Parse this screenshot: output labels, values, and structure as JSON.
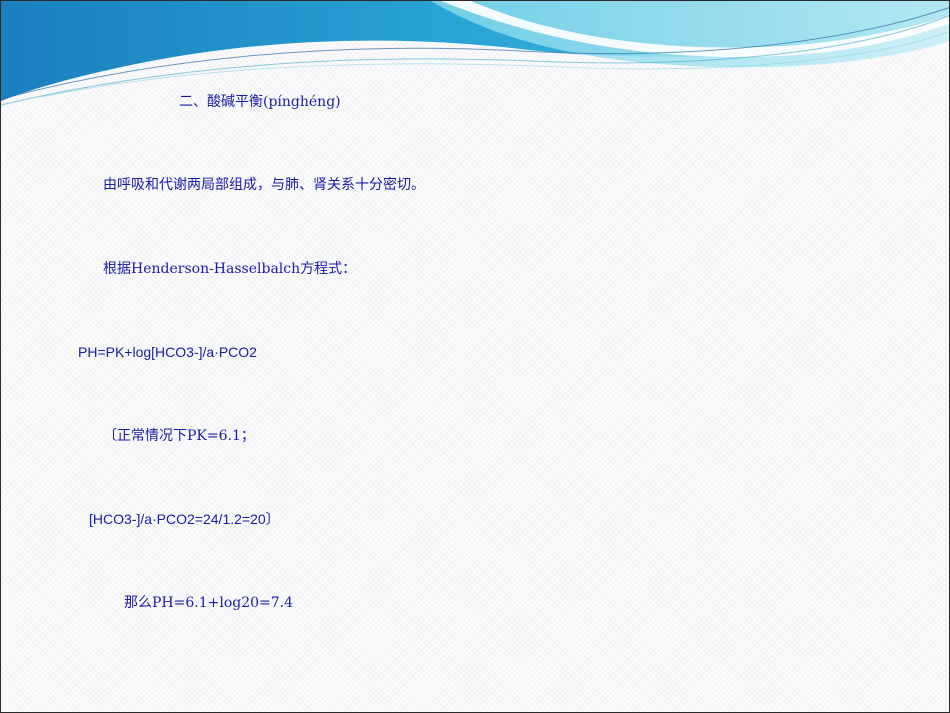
{
  "slide": {
    "lines": [
      "二、酸碱平衡(pínghéng)",
      "由呼吸和代谢两局部组成，与肺、肾关系十分密切。",
      "根据Henderson-Hasselbalch方程式：",
      "PH=PK+log[HCO3-]/a·PCO2",
      "〔正常情况下PK=6.1；",
      "[HCO3-]/a·PCO2=24/1.2=20〕",
      "那么PH=6.1+log20=7.4"
    ]
  },
  "colors": {
    "text": "#1a1aa6",
    "wave_dark": "#1e90c8",
    "wave_mid": "#5cc8e0",
    "wave_light": "#a8e4ef"
  }
}
